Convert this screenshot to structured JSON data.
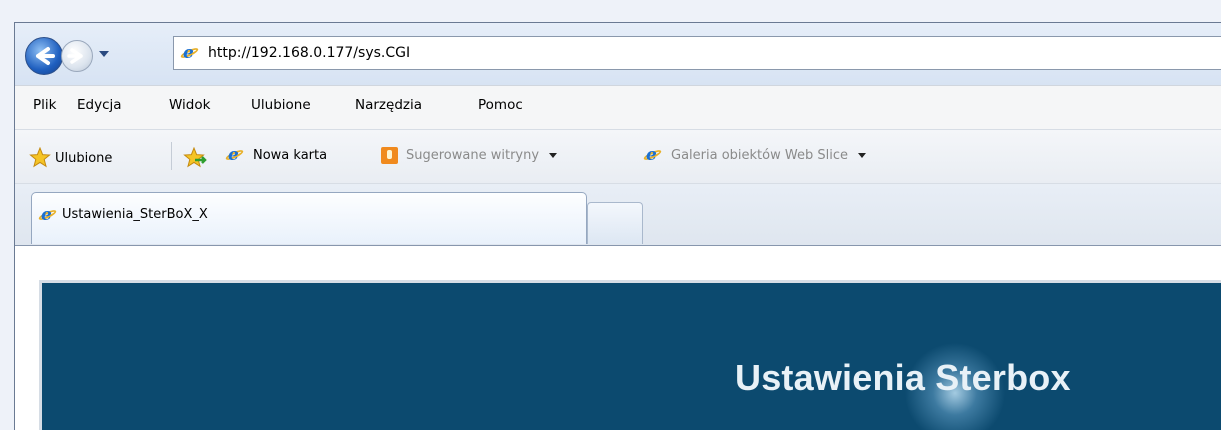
{
  "address": {
    "url": "http://192.168.0.177/sys.CGI"
  },
  "menu": {
    "items": [
      {
        "label": "Plik"
      },
      {
        "label": "Edycja"
      },
      {
        "label": "Widok"
      },
      {
        "label": "Ulubione"
      },
      {
        "label": "Narzędzia"
      },
      {
        "label": "Pomoc"
      }
    ]
  },
  "favorites": {
    "favorites_label": "Ulubione",
    "new_tab_label": "Nowa karta",
    "suggested_sites_label": "Sugerowane witryny",
    "web_slice_label": "Galeria obiektów Web Slice"
  },
  "tabs": [
    {
      "title": "Ustawienia_SterBoX_X"
    }
  ],
  "page": {
    "banner_title": "Ustawienia Sterbox"
  },
  "colors": {
    "banner_background": "#0c4a6f",
    "banner_text": "#e8f1f7",
    "dimmed_text": "#8a8a8a"
  }
}
